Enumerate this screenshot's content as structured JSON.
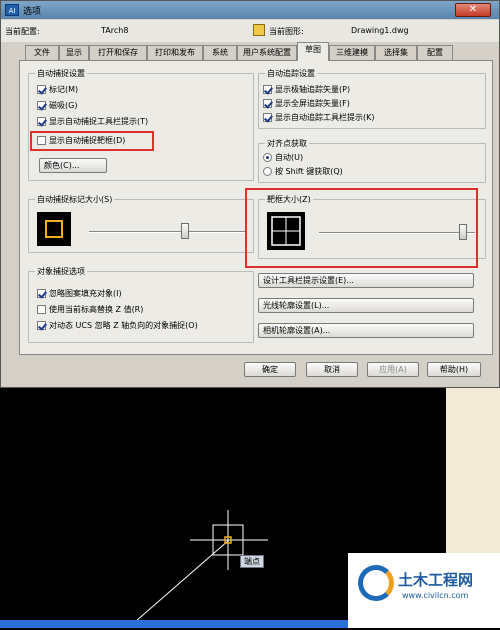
{
  "window": {
    "title": "选项",
    "app_icon_text": "AI",
    "close_label": "✕"
  },
  "profile": {
    "current_profile_label": "当前配置:",
    "current_profile_value": "TArch8",
    "current_drawing_label": "当前图形:",
    "current_drawing_value": "Drawing1.dwg"
  },
  "tabs": [
    "文件",
    "显示",
    "打开和保存",
    "打印和发布",
    "系统",
    "用户系统配置",
    "草图",
    "三维建模",
    "选择集",
    "配置"
  ],
  "active_tab": "草图",
  "autosnap": {
    "title": "自动捕捉设置",
    "options": [
      {
        "label": "标记(M)",
        "checked": true
      },
      {
        "label": "磁吸(G)",
        "checked": true
      },
      {
        "label": "显示自动捕捉工具栏提示(T)",
        "checked": true
      },
      {
        "label": "显示自动捕捉靶框(D)",
        "checked": false
      }
    ],
    "color_button": "颜色(C)..."
  },
  "autotrack": {
    "title": "自动追踪设置",
    "options": [
      {
        "label": "显示极轴追踪矢量(P)",
        "checked": true
      },
      {
        "label": "显示全屏追踪矢量(F)",
        "checked": true
      },
      {
        "label": "显示自动追踪工具栏提示(K)",
        "checked": true
      }
    ]
  },
  "alignment": {
    "title": "对齐点获取",
    "options": [
      {
        "label": "自动(U)",
        "selected": true
      },
      {
        "label": "按 Shift 键获取(Q)",
        "selected": false
      }
    ]
  },
  "marker_size": {
    "title": "自动捕捉标记大小(S)"
  },
  "aperture_size": {
    "title": "靶框大小(Z)"
  },
  "object_snap": {
    "title": "对象捕捉选项",
    "options": [
      {
        "label": "忽略图案填充对象(I)",
        "checked": true
      },
      {
        "label": "使用当前标高替换 Z 值(R)",
        "checked": false
      },
      {
        "label": "对动态 UCS 忽略 Z 轴负向的对象捕捉(O)",
        "checked": true
      }
    ]
  },
  "right_buttons": [
    "设计工具栏提示设置(E)...",
    "光线轮廓设置(L)...",
    "相机轮廓设置(A)..."
  ],
  "bottom_buttons": [
    {
      "label": "确定",
      "disabled": false
    },
    {
      "label": "取消",
      "disabled": false
    },
    {
      "label": "应用(A)",
      "disabled": true
    },
    {
      "label": "帮助(H)",
      "disabled": false
    }
  ],
  "canvas": {
    "tooltip": "端点"
  },
  "watermark": {
    "title": "土木工程网",
    "url": "www.civilcn.com"
  },
  "colors": {
    "marker": "#f0b020",
    "aperture": "#ffffff",
    "highlight": "#e0302a"
  }
}
